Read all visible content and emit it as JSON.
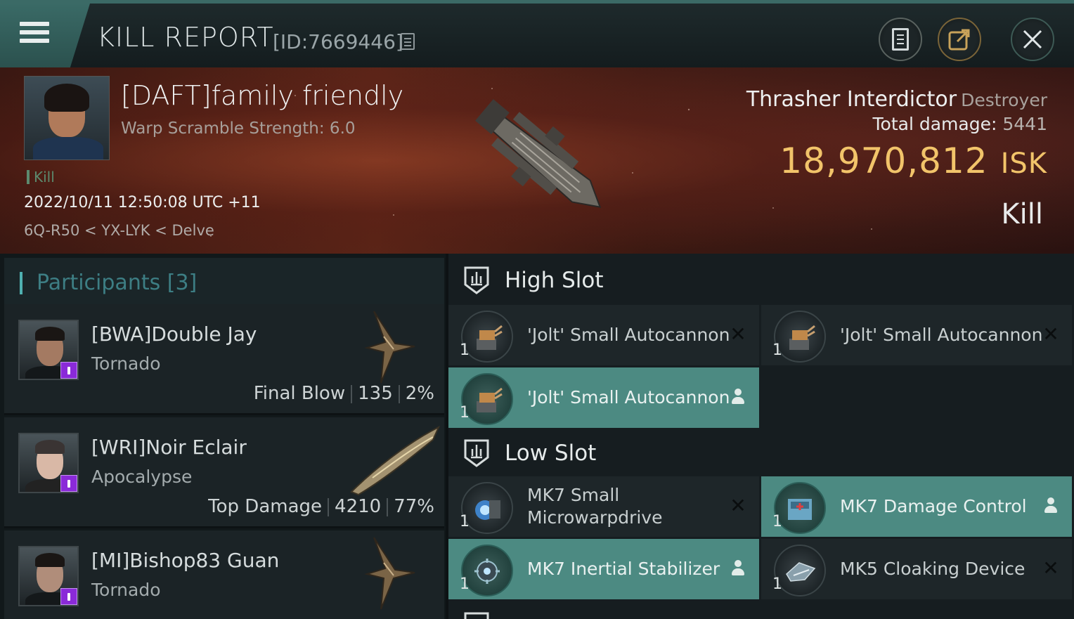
{
  "header": {
    "title": "KILL REPORT",
    "report_id": "[ID:7669446]"
  },
  "victim": {
    "name": "[DAFT]family friendly",
    "warp_scramble": "Warp Scramble Strength: 6.0",
    "tag": "Kill",
    "datetime": "2022/10/11 12:50:08 UTC +11",
    "location": "6Q-R50 < YX-LYK < Delve",
    "ship_name": "Thrasher Interdictor",
    "ship_class": "Destroyer",
    "total_damage_label": "Total damage:",
    "total_damage": "5441",
    "isk_value": "18,970,812",
    "isk_unit": "ISK",
    "result": "Kill"
  },
  "participants": {
    "title": "Participants [3]",
    "items": [
      {
        "name": "[BWA]Double Jay",
        "ship": "Tornado",
        "role": "Final Blow",
        "damage": "135",
        "percent": "2%"
      },
      {
        "name": "[WRI]Noir Eclair",
        "ship": "Apocalypse",
        "role": "Top Damage",
        "damage": "4210",
        "percent": "77%"
      },
      {
        "name": "[MI]Bishop83 Guan",
        "ship": "Tornado"
      }
    ]
  },
  "fitting": {
    "high_slot": {
      "title": "High Slot",
      "modules": [
        {
          "qty": "1",
          "name": "'Jolt' Small Autocannon",
          "status": "destroyed"
        },
        {
          "qty": "1",
          "name": "'Jolt' Small Autocannon",
          "status": "destroyed"
        },
        {
          "qty": "1",
          "name": "'Jolt' Small Autocannon",
          "status": "dropped"
        }
      ]
    },
    "low_slot": {
      "title": "Low Slot",
      "modules": [
        {
          "qty": "1",
          "name": "MK7 Small Microwarpdrive",
          "status": "destroyed"
        },
        {
          "qty": "1",
          "name": "MK7 Damage Control",
          "status": "dropped"
        },
        {
          "qty": "1",
          "name": "MK7 Inertial Stabilizer",
          "status": "dropped"
        },
        {
          "qty": "1",
          "name": "MK5 Cloaking Device",
          "status": "destroyed"
        }
      ]
    }
  },
  "colors": {
    "accent_teal": "#4c8a82",
    "isk_gold": "#f2c46a",
    "badge_purple": "#8a2ad8"
  }
}
